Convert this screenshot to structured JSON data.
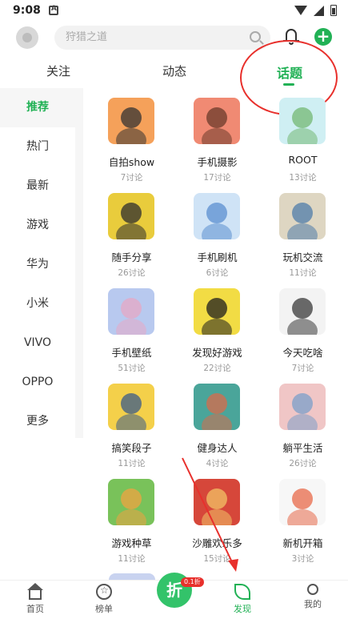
{
  "status": {
    "time": "9:08"
  },
  "search": {
    "placeholder": "狩猎之道"
  },
  "tabs": [
    {
      "label": "关注"
    },
    {
      "label": "动态"
    },
    {
      "label": "话题",
      "active": true
    }
  ],
  "sidebar": {
    "items": [
      {
        "label": "推荐",
        "active": true
      },
      {
        "label": "热门"
      },
      {
        "label": "最新"
      },
      {
        "label": "游戏"
      },
      {
        "label": "华为"
      },
      {
        "label": "小米"
      },
      {
        "label": "VIVO"
      },
      {
        "label": "OPPO"
      },
      {
        "label": "更多"
      }
    ]
  },
  "topics": [
    {
      "name": "自拍show",
      "count": "7讨论",
      "color": "#f5a15a",
      "accent": "#333333"
    },
    {
      "name": "手机摄影",
      "count": "17讨论",
      "color": "#f08a73",
      "accent": "#6b3a2a"
    },
    {
      "name": "ROOT",
      "count": "13讨论",
      "color": "#cfeff3",
      "accent": "#74b873"
    },
    {
      "name": "随手分享",
      "count": "26讨论",
      "color": "#e9cc3c",
      "accent": "#2d2d2d"
    },
    {
      "name": "手机刷机",
      "count": "6讨论",
      "color": "#cfe3f6",
      "accent": "#5b8fd0"
    },
    {
      "name": "玩机交流",
      "count": "11讨论",
      "color": "#ded6c2",
      "accent": "#4f7caa"
    },
    {
      "name": "手机壁纸",
      "count": "51讨论",
      "color": "#b8c9ef",
      "accent": "#e7a7c4"
    },
    {
      "name": "发现好游戏",
      "count": "22讨论",
      "color": "#f2dc44",
      "accent": "#1e1e1e"
    },
    {
      "name": "今天吃啥",
      "count": "7讨论",
      "color": "#f3f3f3",
      "accent": "#3a3a3a"
    },
    {
      "name": "搞笑段子",
      "count": "11讨论",
      "color": "#f4d04a",
      "accent": "#3b5b8a"
    },
    {
      "name": "健身达人",
      "count": "4讨论",
      "color": "#4aa59a",
      "accent": "#d96b4a"
    },
    {
      "name": "躺平生活",
      "count": "26讨论",
      "color": "#f0c6c6",
      "accent": "#7b9fc9"
    },
    {
      "name": "游戏种草",
      "count": "11讨论",
      "color": "#79c25a",
      "accent": "#f0a341"
    },
    {
      "name": "沙雕欢乐多",
      "count": "15讨论",
      "color": "#d6473a",
      "accent": "#f2c266"
    },
    {
      "name": "新机开箱",
      "count": "3讨论",
      "color": "#f7f7f7",
      "accent": "#e86a4a"
    }
  ],
  "bottom_nav": [
    {
      "label": "首页",
      "icon": "home-icon"
    },
    {
      "label": "榜单",
      "icon": "ranking-icon"
    },
    {
      "label": "发现",
      "icon": "discover-icon",
      "active": true
    },
    {
      "label": "我的",
      "icon": "profile-icon"
    }
  ],
  "center_button": {
    "label": "折",
    "badge": "0.1折"
  },
  "colors": {
    "accent": "#21b155",
    "annotation": "#e8302c"
  }
}
